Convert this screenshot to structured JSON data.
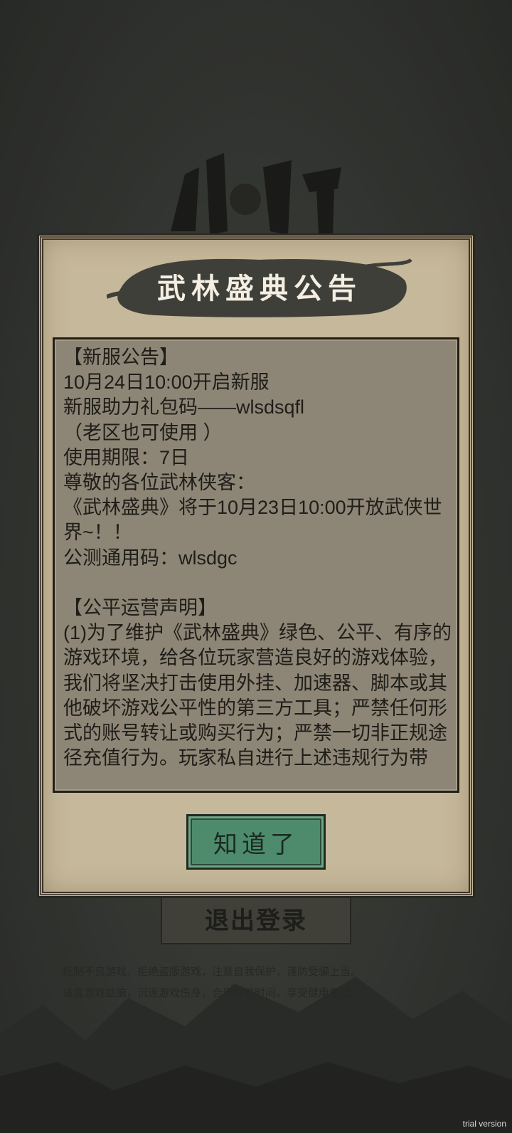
{
  "background": {
    "logout_label": "退出登录",
    "health_notice_line1": "抵制不良游戏，拒绝盗版游戏，注意自我保护，谨防受骗上当。",
    "health_notice_line2": "适度游戏益脑，沉迷游戏伤身，合理安排时间，享受健康生活。"
  },
  "dialog": {
    "title": "武林盛典公告",
    "lines": [
      "【新服公告】",
      "10月24日10:00开启新服",
      "新服助力礼包码——wlsdsqfl",
      "（老区也可使用 ）",
      "使用期限：7日",
      "尊敬的各位武林侠客：",
      "《武林盛典》将于10月23日10:00开放武侠世界~！！",
      "公测通用码：wlsdgc",
      "",
      "【公平运营声明】",
      "(1)为了维护《武林盛典》绿色、公平、有序的游戏环境，给各位玩家营造良好的游戏体验，我们将坚决打击使用外挂、加速器、脚本或其他破坏游戏公平性的第三方工具；严禁任何形式的账号转让或购买行为；严禁一切非正规途径充值行为。玩家私自进行上述违规行为带"
    ],
    "confirm_label": "知道了"
  },
  "watermark": "trial version",
  "colors": {
    "dialog_bg": "#c6b89a",
    "content_bg": "#8d8576",
    "confirm_bg": "#4e8a6c",
    "title_text": "#f4efe2"
  }
}
